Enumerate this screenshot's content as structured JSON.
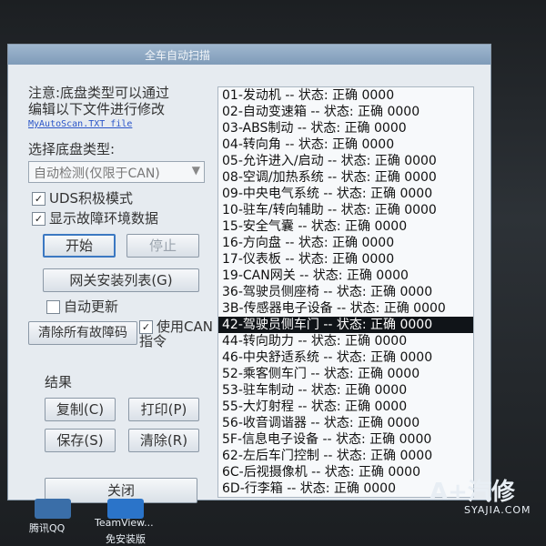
{
  "window": {
    "title": "全车自动扫描"
  },
  "notice": {
    "line1": "注意:底盘类型可以通过",
    "line2": "编辑以下文件进行修改",
    "link": "MyAutoScan.TXT file"
  },
  "chassis": {
    "label": "选择底盘类型:",
    "selected": "自动检测(仅限于CAN)"
  },
  "options": {
    "uds": "UDS积极模式",
    "fault_env": "显示故障环境数据",
    "auto_update": "自动更新",
    "use_can": "使用CAN 指令"
  },
  "buttons": {
    "start": "开始",
    "stop": "停止",
    "gateway": "网关安装列表(G)",
    "clear_all": "清除所有故障码",
    "copy": "复制(C)",
    "print": "打印(P)",
    "save": "保存(S)",
    "clear": "清除(R)",
    "close": "关闭"
  },
  "results_label": "结果",
  "modules": [
    "01-发动机 -- 状态: 正确 0000",
    "02-自动变速箱 -- 状态: 正确 0000",
    "03-ABS制动 -- 状态: 正确 0000",
    "04-转向角 -- 状态: 正确 0000",
    "05-允许进入/启动 -- 状态: 正确 0000",
    "08-空调/加热系统 -- 状态: 正确 0000",
    "09-中央电气系统 -- 状态: 正确 0000",
    "10-驻车/转向辅助 -- 状态: 正确 0000",
    "15-安全气囊 -- 状态: 正确 0000",
    "16-方向盘 -- 状态: 正确 0000",
    "17-仪表板 -- 状态: 正确 0000",
    "19-CAN网关 -- 状态: 正确 0000",
    "36-驾驶员侧座椅 -- 状态: 正确 0000",
    "3B-传感器电子设备 -- 状态: 正确 0000",
    "42-驾驶员侧车门 -- 状态: 正确 0000",
    "44-转向助力 -- 状态: 正确 0000",
    "46-中央舒适系统 -- 状态: 正确 0000",
    "52-乘客侧车门 -- 状态: 正确 0000",
    "53-驻车制动 -- 状态: 正确 0000",
    "55-大灯射程 -- 状态: 正确 0000",
    "56-收音调谐器 -- 状态: 正确 0000",
    "5F-信息电子设备 -- 状态: 正确 0000",
    "62-左后车门控制 -- 状态: 正确 0000",
    "6C-后视摄像机 -- 状态: 正确 0000",
    "6D-行李箱 -- 状态: 正确 0000"
  ],
  "selected_module_index": 14,
  "desktop": {
    "qq": "腾讯QQ",
    "teamviewer_1": "TeamView...",
    "teamviewer_2": "免安装版"
  },
  "watermark": {
    "brand": "A+汽修",
    "site": "SYAJIA.COM"
  }
}
